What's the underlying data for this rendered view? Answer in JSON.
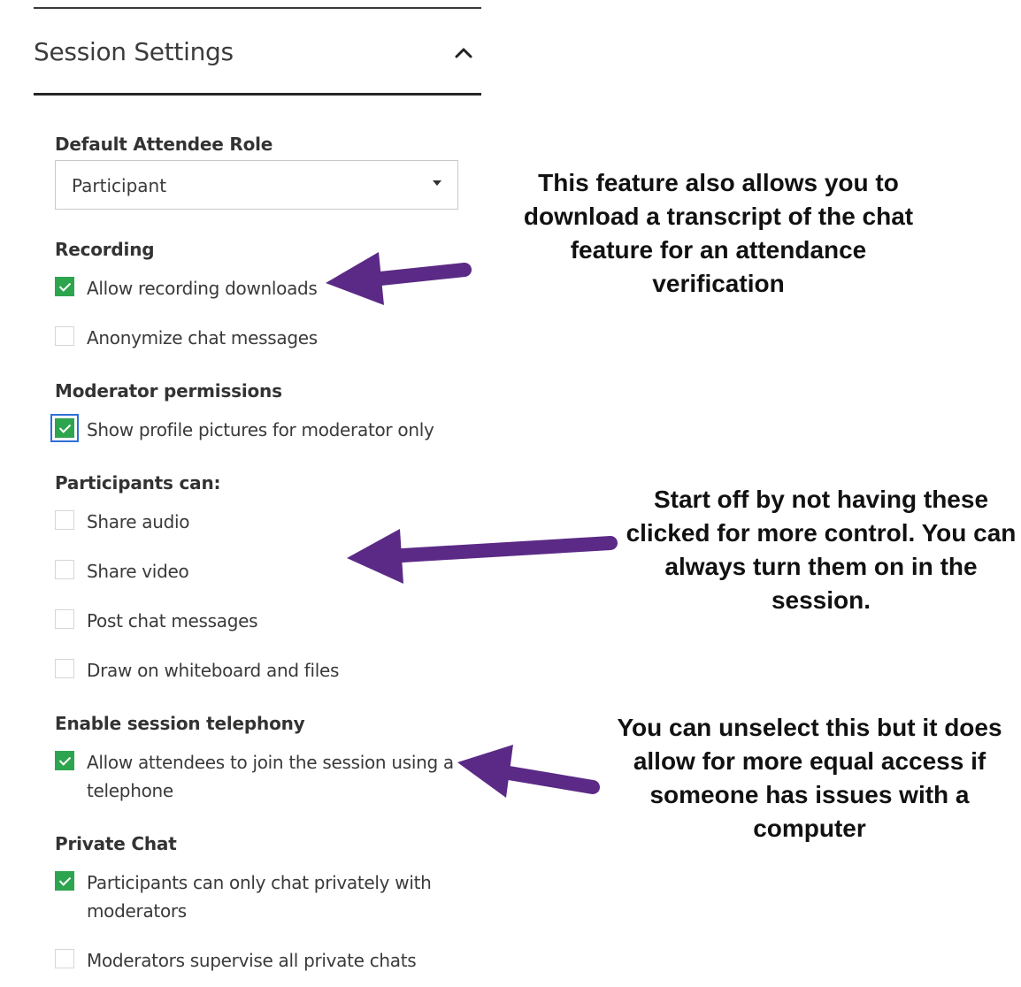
{
  "section": {
    "title": "Session Settings"
  },
  "default_role": {
    "label": "Default Attendee Role",
    "value": "Participant"
  },
  "recording": {
    "label": "Recording",
    "options": [
      {
        "label": "Allow recording downloads",
        "checked": true
      },
      {
        "label": "Anonymize chat messages",
        "checked": false
      }
    ]
  },
  "moderator": {
    "label": "Moderator permissions",
    "options": [
      {
        "label": "Show profile pictures for moderator only",
        "checked": true
      }
    ]
  },
  "participants": {
    "label": "Participants can:",
    "options": [
      {
        "label": "Share audio",
        "checked": false
      },
      {
        "label": "Share video",
        "checked": false
      },
      {
        "label": "Post chat messages",
        "checked": false
      },
      {
        "label": "Draw on whiteboard and files",
        "checked": false
      }
    ]
  },
  "telephony": {
    "label": "Enable session telephony",
    "options": [
      {
        "label": "Allow attendees to join the session using a telephone",
        "checked": true
      }
    ]
  },
  "private_chat": {
    "label": "Private Chat",
    "options": [
      {
        "label": "Participants can only chat privately with moderators",
        "checked": true
      },
      {
        "label": "Moderators supervise all private chats",
        "checked": false
      }
    ]
  },
  "annotations": {
    "recording_note": "This feature also allows you to download a transcript of the chat feature for an attendance verification",
    "participants_note": "Start off by not having these clicked for more control. You can always turn them on in the session.",
    "telephony_note": "You can unselect this but it does allow for more equal access if someone has issues with a computer"
  },
  "colors": {
    "arrow": "#5b2a86",
    "checkbox_checked": "#2da44e",
    "focus_ring": "#2f6fd6"
  },
  "icons": {
    "collapse": "chevron-up-icon",
    "dropdown": "caret-down-icon",
    "check": "checkmark-icon",
    "pointer": "arrow-left-icon"
  }
}
